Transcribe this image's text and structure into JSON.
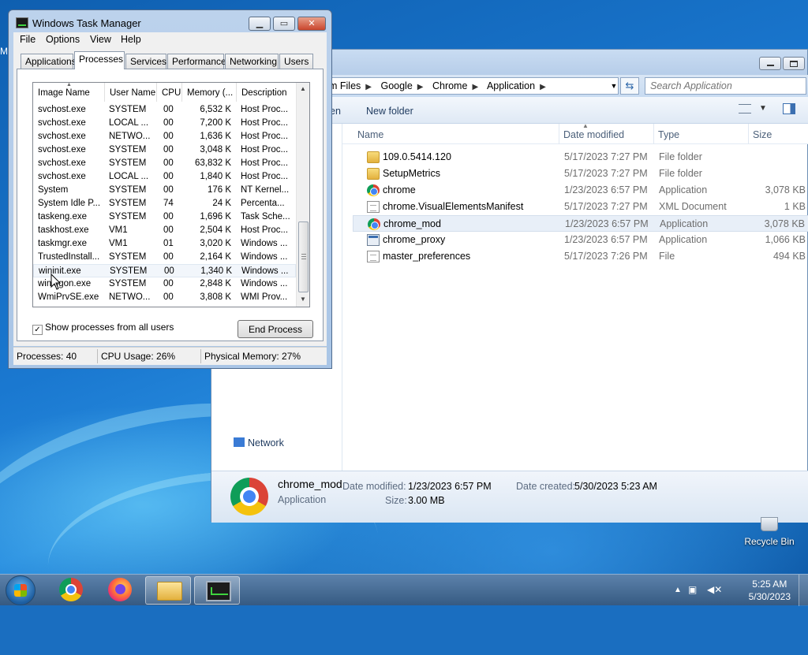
{
  "desktop": {
    "edge_text": "M",
    "recycle_bin_label": "Recycle Bin"
  },
  "explorer": {
    "address_parts": [
      "m Files",
      "Google",
      "Chrome",
      "Application"
    ],
    "search_placeholder": "Search Application",
    "toolbar": {
      "partial_label": "en",
      "new_folder": "New folder"
    },
    "columns": {
      "name": "Name",
      "date_modified": "Date modified",
      "type": "Type",
      "size": "Size"
    },
    "files": [
      {
        "name": "109.0.5414.120",
        "date": "5/17/2023 7:27 PM",
        "type": "File folder",
        "size": "",
        "icon": "folder-icon"
      },
      {
        "name": "SetupMetrics",
        "date": "5/17/2023 7:27 PM",
        "type": "File folder",
        "size": "",
        "icon": "folder-icon"
      },
      {
        "name": "chrome",
        "date": "1/23/2023 6:57 PM",
        "type": "Application",
        "size": "3,078 KB",
        "icon": "chrome-icon"
      },
      {
        "name": "chrome.VisualElementsManifest",
        "date": "5/17/2023 7:27 PM",
        "type": "XML Document",
        "size": "1 KB",
        "icon": "xml-document-icon"
      },
      {
        "name": "chrome_mod",
        "date": "1/23/2023 6:57 PM",
        "type": "Application",
        "size": "3,078 KB",
        "icon": "chrome-icon",
        "selected": true
      },
      {
        "name": "chrome_proxy",
        "date": "1/23/2023 6:57 PM",
        "type": "Application",
        "size": "1,066 KB",
        "icon": "application-icon"
      },
      {
        "name": "master_preferences",
        "date": "5/17/2023 7:26 PM",
        "type": "File",
        "size": "494 KB",
        "icon": "file-icon"
      }
    ],
    "nav_network": "Network",
    "details": {
      "name": "chrome_mod",
      "type": "Application",
      "date_modified_label": "Date modified:",
      "date_modified": "1/23/2023 6:57 PM",
      "date_created_label": "Date created:",
      "date_created": "5/30/2023 5:23 AM",
      "size_label": "Size:",
      "size": "3.00 MB"
    }
  },
  "taskmgr": {
    "title": "Windows Task Manager",
    "menu": [
      "File",
      "Options",
      "View",
      "Help"
    ],
    "tabs": [
      "Applications",
      "Processes",
      "Services",
      "Performance",
      "Networking",
      "Users"
    ],
    "active_tab": "Processes",
    "columns": {
      "image": "Image Name",
      "user": "User Name",
      "cpu": "CPU",
      "memory": "Memory (...",
      "desc": "Description"
    },
    "processes": [
      {
        "image": "svchost.exe",
        "user": "SYSTEM",
        "cpu": "00",
        "memory": "6,532 K",
        "desc": "Host Proc..."
      },
      {
        "image": "svchost.exe",
        "user": "LOCAL ...",
        "cpu": "00",
        "memory": "7,200 K",
        "desc": "Host Proc..."
      },
      {
        "image": "svchost.exe",
        "user": "NETWO...",
        "cpu": "00",
        "memory": "1,636 K",
        "desc": "Host Proc..."
      },
      {
        "image": "svchost.exe",
        "user": "SYSTEM",
        "cpu": "00",
        "memory": "3,048 K",
        "desc": "Host Proc..."
      },
      {
        "image": "svchost.exe",
        "user": "SYSTEM",
        "cpu": "00",
        "memory": "63,832 K",
        "desc": "Host Proc..."
      },
      {
        "image": "svchost.exe",
        "user": "LOCAL ...",
        "cpu": "00",
        "memory": "1,840 K",
        "desc": "Host Proc..."
      },
      {
        "image": "System",
        "user": "SYSTEM",
        "cpu": "00",
        "memory": "176 K",
        "desc": "NT Kernel..."
      },
      {
        "image": "System Idle P...",
        "user": "SYSTEM",
        "cpu": "74",
        "memory": "24 K",
        "desc": "Percenta..."
      },
      {
        "image": "taskeng.exe",
        "user": "SYSTEM",
        "cpu": "00",
        "memory": "1,696 K",
        "desc": "Task Sche..."
      },
      {
        "image": "taskhost.exe",
        "user": "VM1",
        "cpu": "00",
        "memory": "2,504 K",
        "desc": "Host Proc..."
      },
      {
        "image": "taskmgr.exe",
        "user": "VM1",
        "cpu": "01",
        "memory": "3,020 K",
        "desc": "Windows ..."
      },
      {
        "image": "TrustedInstall...",
        "user": "SYSTEM",
        "cpu": "00",
        "memory": "2,164 K",
        "desc": "Windows ..."
      },
      {
        "image": "wininit.exe",
        "user": "SYSTEM",
        "cpu": "00",
        "memory": "1,340 K",
        "desc": "Windows ...",
        "selected": true
      },
      {
        "image": "winlogon.exe",
        "user": "SYSTEM",
        "cpu": "00",
        "memory": "2,848 K",
        "desc": "Windows ..."
      },
      {
        "image": "WmiPrvSE.exe",
        "user": "NETWO...",
        "cpu": "00",
        "memory": "3,808 K",
        "desc": "WMI Prov..."
      }
    ],
    "show_all_users_label": "Show processes from all users",
    "show_all_users_checked": "✓",
    "end_process_label": "End Process",
    "status": {
      "processes": "Processes: 40",
      "cpu": "CPU Usage: 26%",
      "memory": "Physical Memory: 27%"
    }
  },
  "taskbar": {
    "items": [
      "chrome-icon",
      "firefox-icon",
      "explorer-folder-icon",
      "task-manager-icon"
    ],
    "clock_time": "5:25 AM",
    "clock_date": "5/30/2023"
  },
  "colors": {
    "selection": "#e8eff8",
    "window_frame": "#bcd2ec",
    "taskbar": "#365a82"
  }
}
